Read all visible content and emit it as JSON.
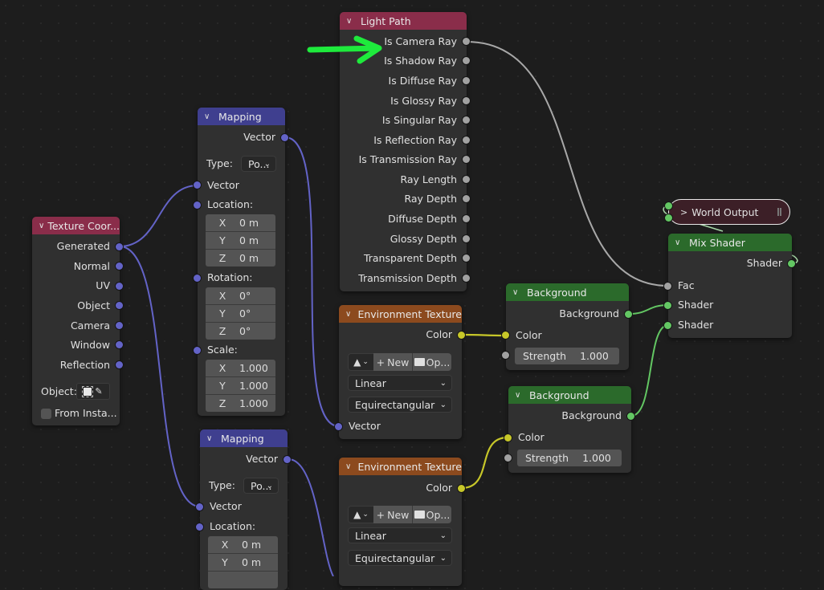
{
  "editor": "Blender Shader Editor (World)",
  "colors": {
    "background": "#1d1d1d",
    "node_body": "#303030",
    "header_input": "#8a2d4a",
    "header_vector": "#3f3f8f",
    "header_texture": "#8c4a1e",
    "header_shader": "#2b6a2b",
    "socket_float": "#a1a1a1",
    "socket_vector": "#6363c7",
    "socket_color": "#c7c729",
    "socket_shader": "#63c763",
    "annotation_arrow": "#1eea3c"
  },
  "nodes": {
    "light_path": {
      "title": "Light Path",
      "outputs": [
        "Is Camera Ray",
        "Is Shadow Ray",
        "Is Diffuse Ray",
        "Is Glossy Ray",
        "Is Singular Ray",
        "Is Reflection Ray",
        "Is Transmission Ray",
        "Ray Length",
        "Ray Depth",
        "Diffuse Depth",
        "Glossy Depth",
        "Transparent Depth",
        "Transmission Depth"
      ]
    },
    "texture_coord": {
      "title": "Texture Coor...",
      "outputs": [
        "Generated",
        "Normal",
        "UV",
        "Object",
        "Camera",
        "Window",
        "Reflection"
      ],
      "object_label": "Object:",
      "from_instancer_label": "From Insta...",
      "from_instancer_checked": false
    },
    "mapping_1": {
      "title": "Mapping",
      "output": "Vector",
      "type_label": "Type:",
      "type_value": "Po...",
      "input_vector": "Vector",
      "location_label": "Location:",
      "location": [
        {
          "axis": "X",
          "value": "0 m"
        },
        {
          "axis": "Y",
          "value": "0 m"
        },
        {
          "axis": "Z",
          "value": "0 m"
        }
      ],
      "rotation_label": "Rotation:",
      "rotation": [
        {
          "axis": "X",
          "value": "0°"
        },
        {
          "axis": "Y",
          "value": "0°"
        },
        {
          "axis": "Z",
          "value": "0°"
        }
      ],
      "scale_label": "Scale:",
      "scale": [
        {
          "axis": "X",
          "value": "1.000"
        },
        {
          "axis": "Y",
          "value": "1.000"
        },
        {
          "axis": "Z",
          "value": "1.000"
        }
      ]
    },
    "mapping_2": {
      "title": "Mapping",
      "output": "Vector",
      "type_label": "Type:",
      "type_value": "Po...",
      "input_vector": "Vector",
      "location_label": "Location:",
      "location": [
        {
          "axis": "X",
          "value": "0 m"
        },
        {
          "axis": "Y",
          "value": "0 m"
        }
      ]
    },
    "env_tex_1": {
      "title": "Environment Texture",
      "output": "Color",
      "new_label": "New",
      "open_label": "Op...",
      "interpolation": "Linear",
      "projection": "Equirectangular",
      "input_vector": "Vector"
    },
    "env_tex_2": {
      "title": "Environment Texture",
      "output": "Color",
      "new_label": "New",
      "open_label": "Op...",
      "interpolation": "Linear",
      "projection": "Equirectangular"
    },
    "background_1": {
      "title": "Background",
      "output": "Background",
      "input_color": "Color",
      "strength_label": "Strength",
      "strength_value": "1.000"
    },
    "background_2": {
      "title": "Background",
      "output": "Background",
      "input_color": "Color",
      "strength_label": "Strength",
      "strength_value": "1.000"
    },
    "mix_shader": {
      "title": "Mix Shader",
      "output": "Shader",
      "inputs": [
        "Fac",
        "Shader",
        "Shader"
      ]
    },
    "world_output": {
      "title": "World Output",
      "collapsed": true
    }
  }
}
